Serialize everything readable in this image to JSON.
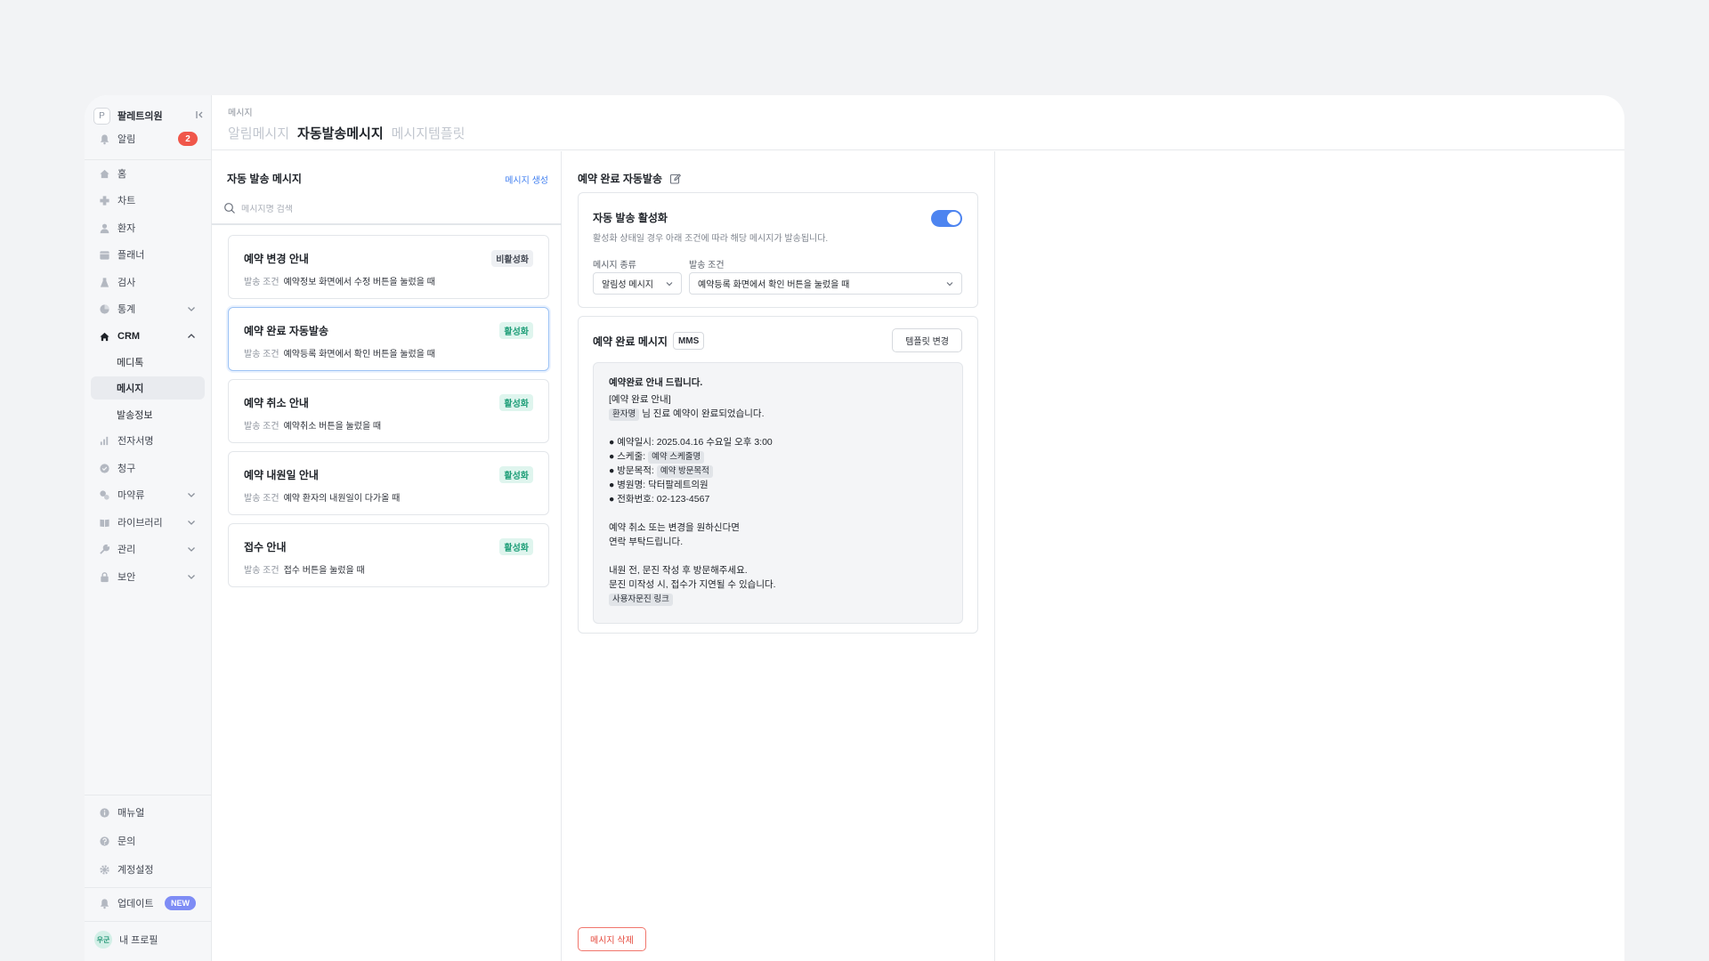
{
  "sidebar": {
    "brand_logo": "P",
    "brand_name": "팔레트의원",
    "notifications": {
      "label": "알림",
      "count": "2"
    },
    "items": [
      {
        "label": "홈",
        "icon": "home-icon"
      },
      {
        "label": "차트",
        "icon": "chart-plus-icon"
      },
      {
        "label": "환자",
        "icon": "patient-icon"
      },
      {
        "label": "플래너",
        "icon": "calendar-icon"
      },
      {
        "label": "검사",
        "icon": "flask-icon"
      },
      {
        "label": "통계",
        "icon": "pie-icon",
        "expandable": true
      },
      {
        "label": "CRM",
        "icon": "crm-home-icon",
        "expanded": true
      },
      {
        "label": "전자서명",
        "icon": "signature-icon"
      },
      {
        "label": "청구",
        "icon": "claim-icon"
      },
      {
        "label": "마약류",
        "icon": "pill-icon",
        "expandable": true
      },
      {
        "label": "라이브러리",
        "icon": "book-icon",
        "expandable": true
      },
      {
        "label": "관리",
        "icon": "wrench-icon",
        "expandable": true
      },
      {
        "label": "보안",
        "icon": "lock-icon",
        "expandable": true
      }
    ],
    "crm_sub": [
      {
        "label": "메디톡"
      },
      {
        "label": "메시지",
        "selected": true
      },
      {
        "label": "발송정보"
      }
    ],
    "bottom": {
      "manual": "매뉴얼",
      "inquiry": "문의",
      "account": "계정설정",
      "update": "업데이트",
      "update_badge": "NEW",
      "profile": "내 프로필",
      "avatar_text": "우군"
    }
  },
  "header": {
    "breadcrumb": "메시지",
    "tabs": [
      "알림메시지",
      "자동발송메시지",
      "메시지템플릿"
    ],
    "active_tab": "자동발송메시지"
  },
  "list": {
    "title": "자동 발송 메시지",
    "create_label": "메시지 생성",
    "search_placeholder": "메시지명 검색",
    "condition_key": "발송 조건",
    "cards": [
      {
        "title": "예약 변경 안내",
        "status": "비활성화",
        "active": false,
        "condition": "예약정보 화면에서 수정 버튼을 눌렀을 때"
      },
      {
        "title": "예약 완료 자동발송",
        "status": "활성화",
        "active": true,
        "condition": "예약등록 화면에서 확인 버튼을 눌렀을 때",
        "selected": true
      },
      {
        "title": "예약 취소 안내",
        "status": "활성화",
        "active": true,
        "condition": "예약취소 버튼을 눌렀을 때"
      },
      {
        "title": "예약 내원일 안내",
        "status": "활성화",
        "active": true,
        "condition": "예약 환자의 내원일이 다가올 때"
      },
      {
        "title": "접수 안내",
        "status": "활성화",
        "active": true,
        "condition": "접수 버튼을 눌렀을 때"
      }
    ]
  },
  "detail": {
    "title": "예약 완료 자동발송",
    "activation": {
      "title": "자동 발송 활성화",
      "desc": "활성화 상태일 경우 아래 조건에 따라 해당 메시지가 발송됩니다.",
      "enabled": true,
      "type_label": "메시지 종류",
      "type_value": "알림성 메시지",
      "cond_label": "발송 조건",
      "cond_value": "예약등록 화면에서 확인 버튼을 눌렀을 때"
    },
    "message": {
      "title": "예약 완료 메시지",
      "type_tag": "MMS",
      "template_btn": "템플릿 변경",
      "heading": "예약완료 안내 드립니다.",
      "line1": "[예약 완료 안내]",
      "patient_chip": "환자명",
      "line2_suffix": "님 진료 예약이 완료되었습니다.",
      "bullet_datetime": "● 예약일시: 2025.04.16 수요일 오후 3:00",
      "bullet_schedule_key": "● 스케줄:",
      "bullet_schedule_chip": "예약 스케줄명",
      "bullet_purpose_key": "● 방문목적:",
      "bullet_purpose_chip": "예약 방문목적",
      "bullet_hospital": "● 병원명: 닥터팔레트의원",
      "bullet_phone": "● 전화번호: 02-123-4567",
      "cancel1": "예약 취소 또는 변경을 원하신다면",
      "cancel2": "연락 부탁드립니다.",
      "visit1": "내원 전, 문진 작성 후 방문해주세요.",
      "visit2": "문진 미작성 시, 접수가 지연될 수 있습니다.",
      "link_chip": "사용자문진 링크"
    },
    "delete_btn": "메시지 삭제"
  },
  "colors": {
    "accent": "#4d84f0",
    "active_status": "#1e9e78",
    "danger": "#e5483b",
    "badge_red": "#f0574a",
    "badge_new": "#7e8cf5"
  }
}
